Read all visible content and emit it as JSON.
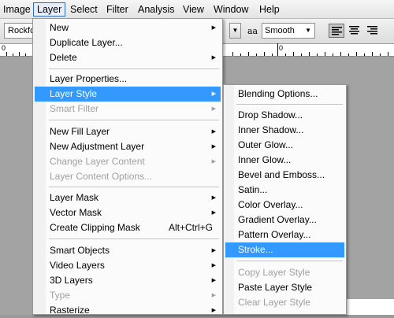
{
  "menubar": {
    "items": [
      "Image",
      "Layer",
      "Select",
      "Filter",
      "Analysis",
      "View",
      "Window",
      "Help"
    ],
    "active": "Layer"
  },
  "options_bar": {
    "font_family": "Rockford",
    "antialias_icon": "aa",
    "antialias_value": "Smooth",
    "align_buttons": [
      "align-left-icon",
      "align-center-icon",
      "align-right-icon"
    ]
  },
  "ruler": {
    "labels": [
      "0",
      "0"
    ]
  },
  "layer_menu": {
    "groups": [
      [
        {
          "label": "New",
          "submenu": true
        },
        {
          "label": "Duplicate Layer..."
        },
        {
          "label": "Delete",
          "submenu": true
        }
      ],
      [
        {
          "label": "Layer Properties..."
        },
        {
          "label": "Layer Style",
          "submenu": true,
          "highlighted": true
        },
        {
          "label": "Smart Filter",
          "submenu": true,
          "disabled": true
        }
      ],
      [
        {
          "label": "New Fill Layer",
          "submenu": true
        },
        {
          "label": "New Adjustment Layer",
          "submenu": true
        },
        {
          "label": "Change Layer Content",
          "submenu": true,
          "disabled": true
        },
        {
          "label": "Layer Content Options...",
          "disabled": true
        }
      ],
      [
        {
          "label": "Layer Mask",
          "submenu": true
        },
        {
          "label": "Vector Mask",
          "submenu": true
        },
        {
          "label": "Create Clipping Mask",
          "shortcut": "Alt+Ctrl+G"
        }
      ],
      [
        {
          "label": "Smart Objects",
          "submenu": true
        },
        {
          "label": "Video Layers",
          "submenu": true
        },
        {
          "label": "3D Layers",
          "submenu": true
        },
        {
          "label": "Type",
          "submenu": true,
          "disabled": true
        },
        {
          "label": "Rasterize",
          "submenu": true
        }
      ]
    ]
  },
  "layer_style_menu": {
    "groups": [
      [
        {
          "label": "Blending Options..."
        }
      ],
      [
        {
          "label": "Drop Shadow..."
        },
        {
          "label": "Inner Shadow..."
        },
        {
          "label": "Outer Glow..."
        },
        {
          "label": "Inner Glow..."
        },
        {
          "label": "Bevel and Emboss..."
        },
        {
          "label": "Satin..."
        },
        {
          "label": "Color Overlay..."
        },
        {
          "label": "Gradient Overlay..."
        },
        {
          "label": "Pattern Overlay..."
        },
        {
          "label": "Stroke...",
          "highlighted": true
        }
      ],
      [
        {
          "label": "Copy Layer Style",
          "disabled": true
        },
        {
          "label": "Paste Layer Style"
        },
        {
          "label": "Clear Layer Style",
          "disabled": true
        }
      ]
    ]
  },
  "colors": {
    "highlight": "#3399ff",
    "disabled_text": "#a0a0a0",
    "menu_bg": "#fbfbfb"
  }
}
